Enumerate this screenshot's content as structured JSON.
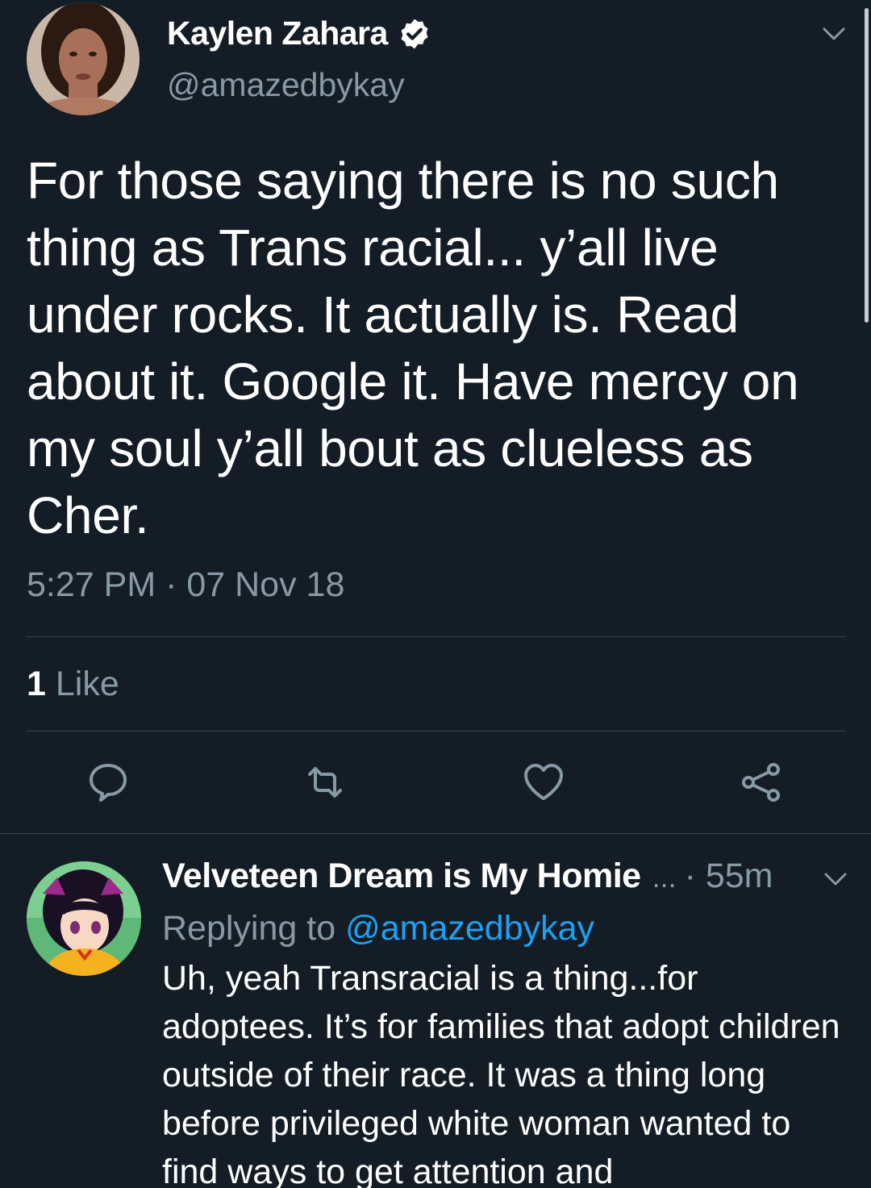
{
  "colors": {
    "background": "#141d26",
    "text_primary": "#ffffff",
    "text_secondary": "#8899a6",
    "link": "#1da1f2",
    "divider": "#38444d"
  },
  "main_tweet": {
    "author": {
      "name": "Kaylen Zahara",
      "handle": "@amazedbykay",
      "verified": true,
      "avatar_icon": "profile-photo"
    },
    "text": "For those saying there is no such thing as Trans racial... y’all live under rocks. It actually is. Read about it. Google it. Have mercy on my soul y’all bout as clueless as Cher.",
    "timestamp": "5:27 PM · 07 Nov 18",
    "likes": {
      "count": "1",
      "label": "Like"
    },
    "actions": [
      {
        "name": "reply",
        "icon": "reply-icon"
      },
      {
        "name": "retweet",
        "icon": "retweet-icon"
      },
      {
        "name": "like",
        "icon": "heart-icon"
      },
      {
        "name": "share",
        "icon": "share-icon"
      }
    ]
  },
  "reply_tweet": {
    "author": {
      "name": "Velveteen Dream is My Homie",
      "ellipsis": "...",
      "avatar_icon": "anime-avatar"
    },
    "time": "· 55m",
    "replying_to_label": "Replying to",
    "replying_to_handle": "@amazedbykay",
    "text": "Uh, yeah Transracial is a thing...for adoptees. It’s for families that adopt children outside of their race. It was a thing long before privileged white woman wanted to find ways to get attention and"
  }
}
